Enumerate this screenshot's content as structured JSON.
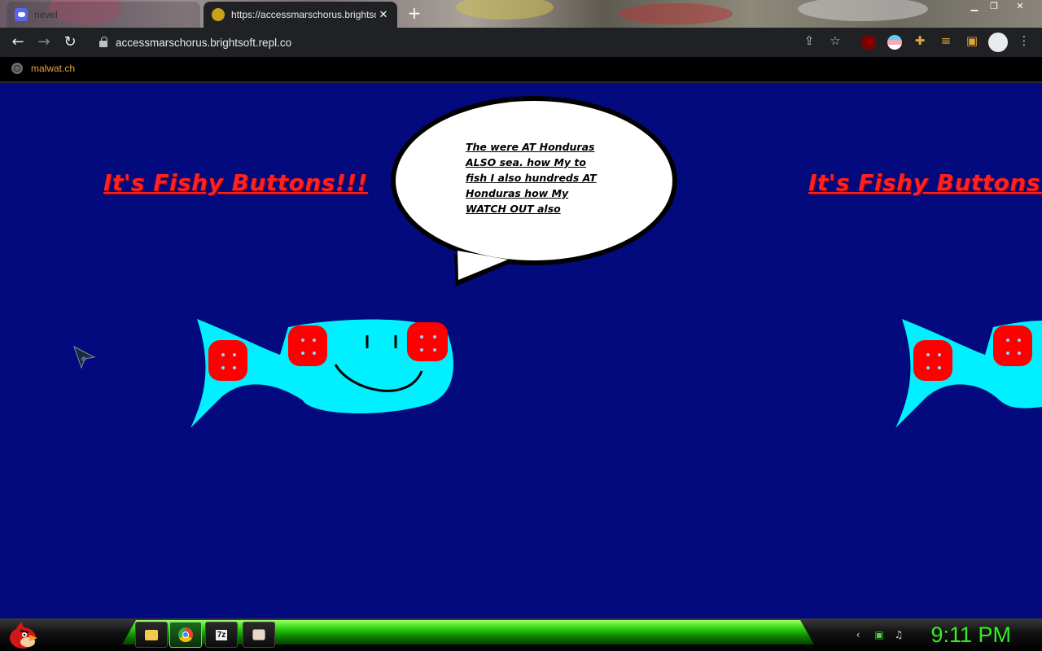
{
  "browser": {
    "tabs": [
      {
        "title": "nevel",
        "active": false
      },
      {
        "title": "https://accessmarschorus.brightsoft.repl.co",
        "active": true
      }
    ],
    "address": "accessmarschorus.brightsoft.repl.co",
    "bookmarks": [
      {
        "label": "malwat.ch"
      }
    ]
  },
  "page": {
    "headline_left": "It's Fishy Buttons!!!",
    "headline_right": "It's Fishy Buttons!!!",
    "speech_bubble": "The were AT Honduras ALSO sea. how My to fish I also hundreds AT Honduras how My WATCH OUT also",
    "background_color": "#020a7e",
    "fish_color": "#00f0ff",
    "button_color": "#ff0000"
  },
  "taskbar": {
    "apps": [
      {
        "icon": "folder-icon"
      },
      {
        "icon": "chrome-icon",
        "active": true
      },
      {
        "icon": "7zip-icon",
        "label": "7z"
      },
      {
        "icon": "app-icon"
      }
    ],
    "clock": "9:11 PM"
  }
}
